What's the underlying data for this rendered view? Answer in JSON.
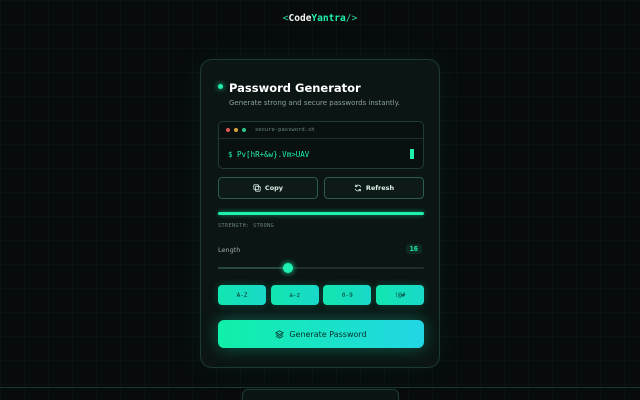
{
  "logo": {
    "open": "<",
    "part1": "Code",
    "part2": "Yantra",
    "close": "/>"
  },
  "card": {
    "title": "Password Generator",
    "subtitle": "Generate strong and secure passwords instantly."
  },
  "terminal": {
    "filename": "secure-password.sh",
    "prompt": "$",
    "password": "Pv[hR+&w}.Vm>UAV"
  },
  "actions": {
    "copy_label": "Copy",
    "refresh_label": "Refresh"
  },
  "strength": {
    "label": "STRENGTH: STRONG",
    "level": 1.0
  },
  "length": {
    "label": "Length",
    "value": "16",
    "slider_fraction": 0.34
  },
  "charsets": [
    {
      "label": "A-Z"
    },
    {
      "label": "a-z"
    },
    {
      "label": "0-9"
    },
    {
      "label": "!@#"
    }
  ],
  "generate": {
    "label": "Generate Password"
  },
  "colors": {
    "accent": "#1ef0b0",
    "accent2": "#22d6e4",
    "background": "#070b0b"
  }
}
